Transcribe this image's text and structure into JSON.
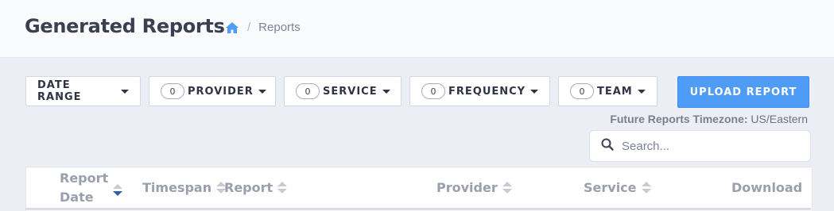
{
  "header": {
    "title": "Generated Reports",
    "breadcrumb": {
      "home_icon": "home-icon",
      "separator": "/",
      "current": "Reports"
    }
  },
  "filters": [
    {
      "id": "date-range",
      "label": "DATE RANGE",
      "count": null
    },
    {
      "id": "provider",
      "label": "PROVIDER",
      "count": "0"
    },
    {
      "id": "service",
      "label": "SERVICE",
      "count": "0"
    },
    {
      "id": "frequency",
      "label": "FREQUENCY",
      "count": "0"
    },
    {
      "id": "team",
      "label": "TEAM",
      "count": "0"
    }
  ],
  "upload_button": "UPLOAD REPORT",
  "timezone": {
    "label": "Future Reports Timezone:",
    "value": "US/Eastern"
  },
  "search": {
    "placeholder": "Search...",
    "value": ""
  },
  "table": {
    "columns": [
      {
        "line1": "Report",
        "line2": "Date",
        "sortable": true,
        "sort": "desc"
      },
      {
        "label": "Timespan",
        "sortable": true
      },
      {
        "label": "Report",
        "sortable": true
      },
      {
        "label": "Provider",
        "sortable": true
      },
      {
        "label": "Service",
        "sortable": true
      },
      {
        "label": "Download",
        "sortable": false
      }
    ]
  },
  "colors": {
    "accent": "#4e9cf6",
    "sort_active": "#2f5fa8",
    "background": "#ebeef4"
  }
}
